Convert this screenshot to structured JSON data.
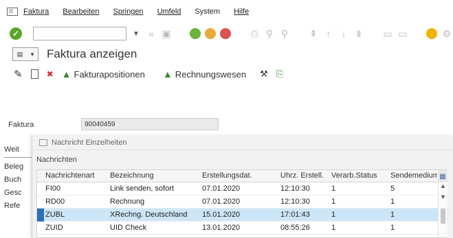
{
  "menu": {
    "items": [
      "Faktura",
      "Bearbeiten",
      "Springen",
      "Umfeld",
      "System",
      "Hilfe"
    ]
  },
  "toolbar": {
    "command_value": "",
    "colors": {
      "ok": "#5aa52b",
      "back": "#6bb33a",
      "exit": "#e8a93a",
      "cancel": "#d9534f",
      "help": "#f0b400"
    }
  },
  "title": "Faktura anzeigen",
  "actions": {
    "fakturapositionen": "Fakturapositionen",
    "rechnungswesen": "Rechnungswesen"
  },
  "faktura": {
    "label": "Faktura",
    "value": "90040459"
  },
  "left_tabs": [
    "Weit",
    "Beleg",
    "Buch",
    "Gesc",
    "Refe"
  ],
  "dialog": {
    "title": "Nachricht Einzelheiten",
    "group_label": "Nachrichten",
    "columns": [
      "Nachrichtenart",
      "Bezeichnung",
      "Erstellungsdat.",
      "Uhrz. Erstell.",
      "Verarb.Status",
      "Sendemedium"
    ],
    "rows": [
      {
        "art": "FI00",
        "bez": "Link senden, sofort",
        "datum": "07.01.2020",
        "zeit": "12:10:30",
        "status": "1",
        "medium": "5",
        "selected": false
      },
      {
        "art": "RD00",
        "bez": "Rechnung",
        "datum": "07.01.2020",
        "zeit": "12:10:30",
        "status": "1",
        "medium": "1",
        "selected": false
      },
      {
        "art": "ZUBL",
        "bez": "XRechng. Deutschland",
        "datum": "15.01.2020",
        "zeit": "17:01:43",
        "status": "1",
        "medium": "1",
        "selected": true
      },
      {
        "art": "ZUID",
        "bez": "UID Check",
        "datum": "13.01.2020",
        "zeit": "08:55:26",
        "status": "1",
        "medium": "1",
        "selected": false
      }
    ]
  }
}
